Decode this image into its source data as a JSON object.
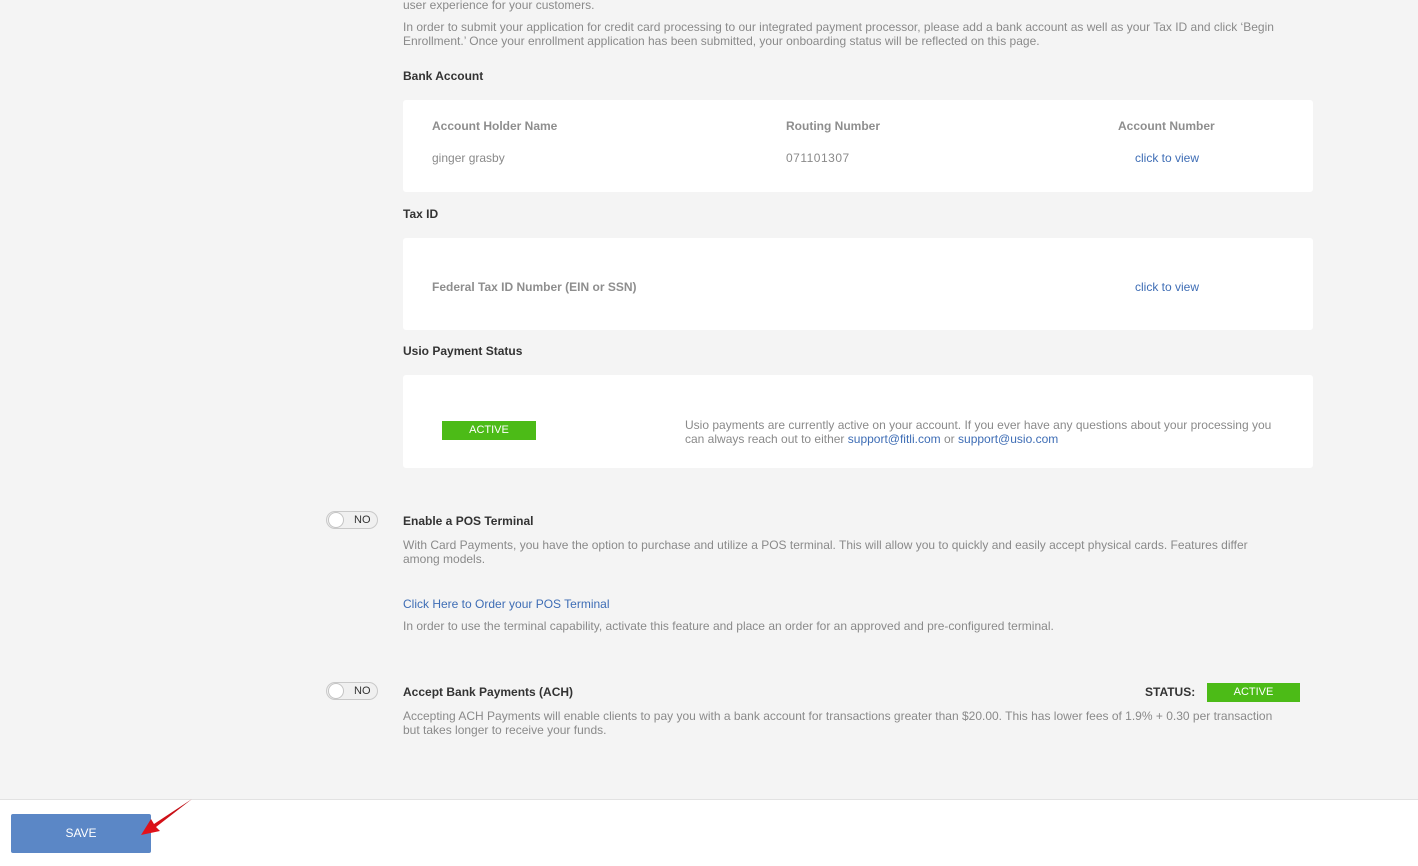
{
  "intro": {
    "fragment": "user experience for your customers.",
    "instructions": "In order to submit your application for credit card processing to our integrated payment processor, please add a bank account as well as your Tax ID and click ‘Begin Enrollment.’ Once your enrollment application has been submitted, your onboarding status will be reflected on this page."
  },
  "bank_account": {
    "heading": "Bank Account",
    "columns": {
      "holder": "Account Holder Name",
      "routing": "Routing Number",
      "account": "Account Number"
    },
    "values": {
      "holder": "ginger grasby",
      "routing": "071101307",
      "account_link": "click to view"
    }
  },
  "tax_id": {
    "heading": "Tax ID",
    "label": "Federal Tax ID Number (EIN or SSN)",
    "link": "click to view"
  },
  "usio_status": {
    "heading": "Usio Payment Status",
    "badge": "ACTIVE",
    "message_pre": "Usio payments are currently active on your account. If you ever have any questions about your processing you can always reach out to either",
    "email1": "support@fitli.com",
    "or": "or",
    "email2": "support@usio.com"
  },
  "pos_terminal": {
    "toggle": "NO",
    "heading": "Enable a POS Terminal",
    "description": "With Card Payments, you have the option to purchase and utilize a POS terminal. This will allow you to quickly and easily accept physical cards. Features differ among models.",
    "order_link": "Click Here to Order your POS Terminal",
    "note": "In order to use the terminal capability, activate this feature and place an order for an approved and pre-configured terminal."
  },
  "ach": {
    "toggle": "NO",
    "heading": "Accept Bank Payments (ACH)",
    "status_label": "STATUS:",
    "status_badge": "ACTIVE",
    "description": "Accepting ACH Payments will enable clients to pay you with a bank account for transactions greater than $20.00. This has lower fees of 1.9% + 0.30 per transaction but takes longer to receive your funds."
  },
  "footer": {
    "save_label": "SAVE"
  },
  "colors": {
    "accent": "#5b87c6",
    "link": "#3e6db5",
    "active": "#4cbb17",
    "annotation_arrow": "#e8131b"
  },
  "icons": {
    "annotation": "red-arrow-icon"
  }
}
